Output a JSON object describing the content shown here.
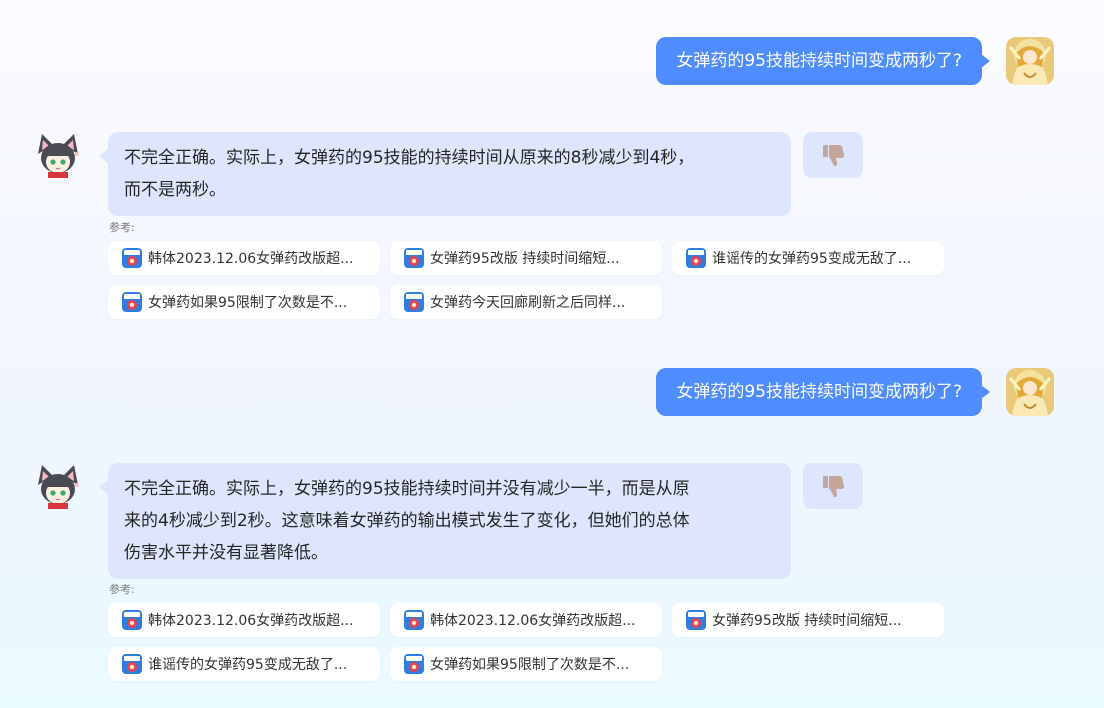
{
  "conversation": [
    {
      "user": {
        "text": "女弹药的95技能持续时间变成两秒了?"
      },
      "bot": {
        "lines": [
          "不完全正确。实际上，女弹药的95技能的持续时间从原来的8秒减少到4秒，",
          "而不是两秒。"
        ],
        "refs_label": "参考:",
        "refs": [
          "韩体2023.12.06女弹药改版超...",
          "女弹药95改版 持续时间缩短...",
          "谁谣传的女弹药95变成无敌了...",
          "女弹药如果95限制了次数是不...",
          "女弹药今天回廊刷新之后同样..."
        ]
      }
    },
    {
      "user": {
        "text": "女弹药的95技能持续时间变成两秒了?"
      },
      "bot": {
        "lines": [
          "不完全正确。实际上，女弹药的95技能持续时间并没有减少一半，而是从原",
          "来的4秒减少到2秒。这意味着女弹药的输出模式发生了变化，但她们的总体",
          "伤害水平并没有显著降低。"
        ],
        "refs_label": "参考:",
        "refs": [
          "韩体2023.12.06女弹药改版超...",
          "韩体2023.12.06女弹药改版超...",
          "女弹药95改版 持续时间缩短...",
          "谁谣传的女弹药95变成无敌了...",
          "女弹药如果95限制了次数是不..."
        ]
      }
    }
  ],
  "icons": {
    "user_avatar": "golden-angel-avatar-icon",
    "bot_avatar": "cat-girl-avatar-icon",
    "dislike": "thumbs-down-icon",
    "source": "colg-source-icon"
  },
  "colors": {
    "user_bubble": "#4f8cff",
    "bot_bubble": "#dde6fc",
    "chip_bg": "#ffffff"
  }
}
